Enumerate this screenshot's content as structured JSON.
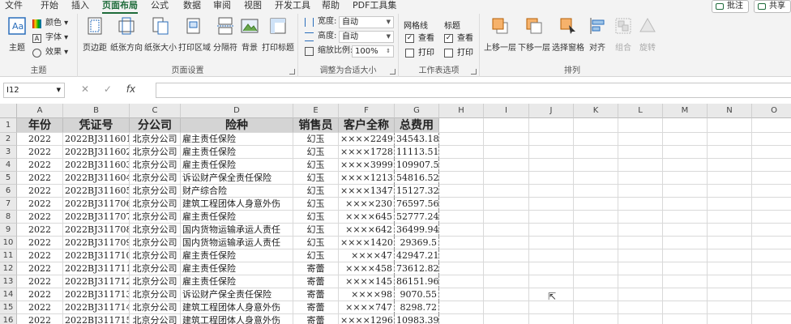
{
  "tabs": [
    "文件",
    "开始",
    "插入",
    "页面布局",
    "公式",
    "数据",
    "审阅",
    "视图",
    "开发工具",
    "帮助",
    "PDF工具集"
  ],
  "top_buttons": {
    "comment": "批注",
    "share": "共享"
  },
  "ribbon": {
    "theme": {
      "theme_btn": "主题",
      "colors": "颜色",
      "fonts": "字体",
      "effects": "效果",
      "group": "主题"
    },
    "page_setup": {
      "margins": "页边距",
      "orientation": "纸张方向",
      "size": "纸张大小",
      "print_area": "打印区域",
      "breaks": "分隔符",
      "background": "背景",
      "print_titles": "打印标题",
      "group": "页面设置"
    },
    "scale": {
      "width_label": "宽度:",
      "width_value": "自动",
      "height_label": "高度:",
      "height_value": "自动",
      "scale_label": "缩放比例:",
      "scale_value": "100%",
      "group": "调整为合适大小"
    },
    "sheet_options": {
      "gridlines": "网格线",
      "headings": "标题",
      "view": "查看",
      "print": "打印",
      "group": "工作表选项"
    },
    "arrange": {
      "bring_forward": "上移一层",
      "send_backward": "下移一层",
      "selection_pane": "选择窗格",
      "align": "对齐",
      "group_btn": "组合",
      "rotate": "旋转",
      "group": "排列"
    }
  },
  "formula_bar": {
    "name_box": "I12",
    "fx": "fx",
    "formula": ""
  },
  "columns": [
    "A",
    "B",
    "C",
    "D",
    "E",
    "F",
    "G",
    "H",
    "I",
    "J",
    "K",
    "L",
    "M",
    "N",
    "O"
  ],
  "rows": [
    "1",
    "2",
    "3",
    "4",
    "5",
    "6",
    "7",
    "8",
    "9",
    "10",
    "11",
    "12",
    "13",
    "14",
    "15",
    "16"
  ],
  "table": {
    "headers": [
      "年份",
      "凭证号",
      "分公司",
      "险种",
      "销售员",
      "客户全称",
      "总费用"
    ],
    "data": [
      [
        "2022",
        "2022BJ311601",
        "北京分公司",
        "雇主责任保险",
        "幻玉",
        "××××2249",
        "34543.18"
      ],
      [
        "2022",
        "2022BJ311602",
        "北京分公司",
        "雇主责任保险",
        "幻玉",
        "××××1728",
        "11113.51"
      ],
      [
        "2022",
        "2022BJ311603",
        "北京分公司",
        "雇主责任保险",
        "幻玉",
        "××××3999",
        "109907.5"
      ],
      [
        "2022",
        "2022BJ311604",
        "北京分公司",
        "诉讼财产保全责任保险",
        "幻玉",
        "××××1213",
        "54816.52"
      ],
      [
        "2022",
        "2022BJ311605",
        "北京分公司",
        "财产综合险",
        "幻玉",
        "××××1347",
        "15127.32"
      ],
      [
        "2022",
        "2022BJ311706",
        "北京分公司",
        "建筑工程团体人身意外伤",
        "幻玉",
        "××××230",
        "76597.56"
      ],
      [
        "2022",
        "2022BJ311707",
        "北京分公司",
        "雇主责任保险",
        "幻玉",
        "××××645",
        "52777.24"
      ],
      [
        "2022",
        "2022BJ311708",
        "北京分公司",
        "国内货物运输承运人责任",
        "幻玉",
        "××××642",
        "36499.94"
      ],
      [
        "2022",
        "2022BJ311709",
        "北京分公司",
        "国内货物运输承运人责任",
        "幻玉",
        "××××1420",
        "29369.5"
      ],
      [
        "2022",
        "2022BJ311710",
        "北京分公司",
        "雇主责任保险",
        "幻玉",
        "××××47",
        "42947.21"
      ],
      [
        "2022",
        "2022BJ311711",
        "北京分公司",
        "雇主责任保险",
        "寄蕾",
        "××××458",
        "73612.82"
      ],
      [
        "2022",
        "2022BJ311712",
        "北京分公司",
        "雇主责任保险",
        "寄蕾",
        "××××145",
        "86151.96"
      ],
      [
        "2022",
        "2022BJ311713",
        "北京分公司",
        "诉讼财产保全责任保险",
        "寄蕾",
        "××××98",
        "9070.55"
      ],
      [
        "2022",
        "2022BJ311714",
        "北京分公司",
        "建筑工程团体人身意外伤",
        "寄蕾",
        "××××747",
        "8298.72"
      ],
      [
        "2022",
        "2022BJ311715",
        "北京分公司",
        "建筑工程团体人身意外伤",
        "寄蕾",
        "××××1296",
        "10983.39"
      ]
    ]
  },
  "colors": {
    "accent": "#1e6b3a",
    "header_fill": "#d4d4d4"
  }
}
